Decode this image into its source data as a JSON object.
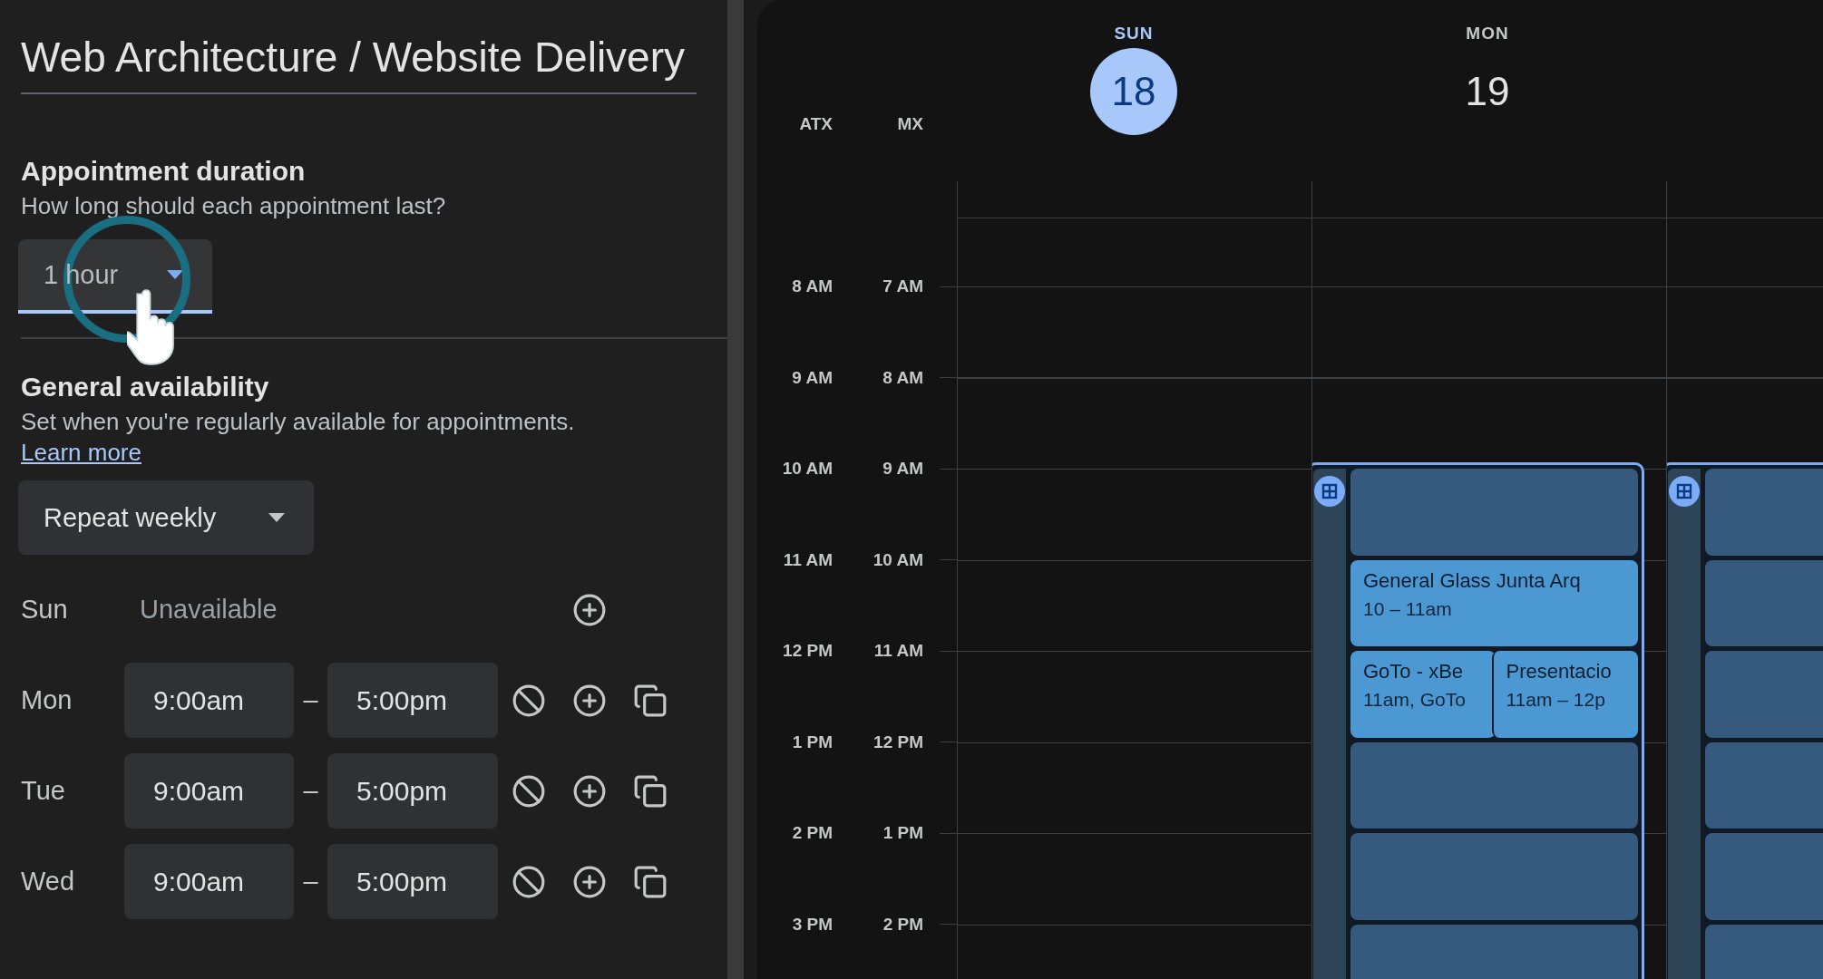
{
  "title": "Web Architecture / Website Delivery",
  "duration": {
    "heading": "Appointment duration",
    "hint": "How long should each appointment last?",
    "value": "1 hour"
  },
  "availability": {
    "heading": "General availability",
    "text": "Set when you're regularly available for appointments.",
    "link": "Learn more",
    "repeat": "Repeat weekly",
    "days": [
      {
        "day": "Sun",
        "available": false,
        "status": "Unavailable"
      },
      {
        "day": "Mon",
        "available": true,
        "start": "9:00am",
        "separator": "–",
        "end": "5:00pm"
      },
      {
        "day": "Tue",
        "available": true,
        "start": "9:00am",
        "separator": "–",
        "end": "5:00pm"
      },
      {
        "day": "Wed",
        "available": true,
        "start": "9:00am",
        "separator": "–",
        "end": "5:00pm"
      }
    ]
  },
  "calendar": {
    "timezones": [
      "ATX",
      "MX"
    ],
    "days": [
      {
        "weekday": "SUN",
        "date": "18",
        "selected": true
      },
      {
        "weekday": "MON",
        "date": "19",
        "selected": false
      }
    ],
    "hours": [
      {
        "atx": "8 AM",
        "mx": "7 AM"
      },
      {
        "atx": "9 AM",
        "mx": "8 AM"
      },
      {
        "atx": "10 AM",
        "mx": "9 AM"
      },
      {
        "atx": "11 AM",
        "mx": "10 AM"
      },
      {
        "atx": "12 PM",
        "mx": "11 AM"
      },
      {
        "atx": "1 PM",
        "mx": "12 PM"
      },
      {
        "atx": "2 PM",
        "mx": "1 PM"
      },
      {
        "atx": "3 PM",
        "mx": "2 PM"
      }
    ],
    "blocks": [
      {
        "slots": [
          {
            "kind": "open"
          },
          {
            "kind": "events",
            "events": [
              {
                "title": "General Glass Junta Arq",
                "time": "10 – 11am"
              }
            ]
          },
          {
            "kind": "events",
            "events": [
              {
                "title": "GoTo - xBe",
                "time": "11am, GoTo"
              },
              {
                "title": "Presentacio",
                "time": "11am – 12p"
              }
            ]
          },
          {
            "kind": "open"
          },
          {
            "kind": "open"
          },
          {
            "kind": "open"
          }
        ]
      },
      {
        "slots": [
          {
            "kind": "open"
          },
          {
            "kind": "open"
          },
          {
            "kind": "open"
          },
          {
            "kind": "open"
          },
          {
            "kind": "open"
          },
          {
            "kind": "open"
          }
        ]
      }
    ]
  }
}
